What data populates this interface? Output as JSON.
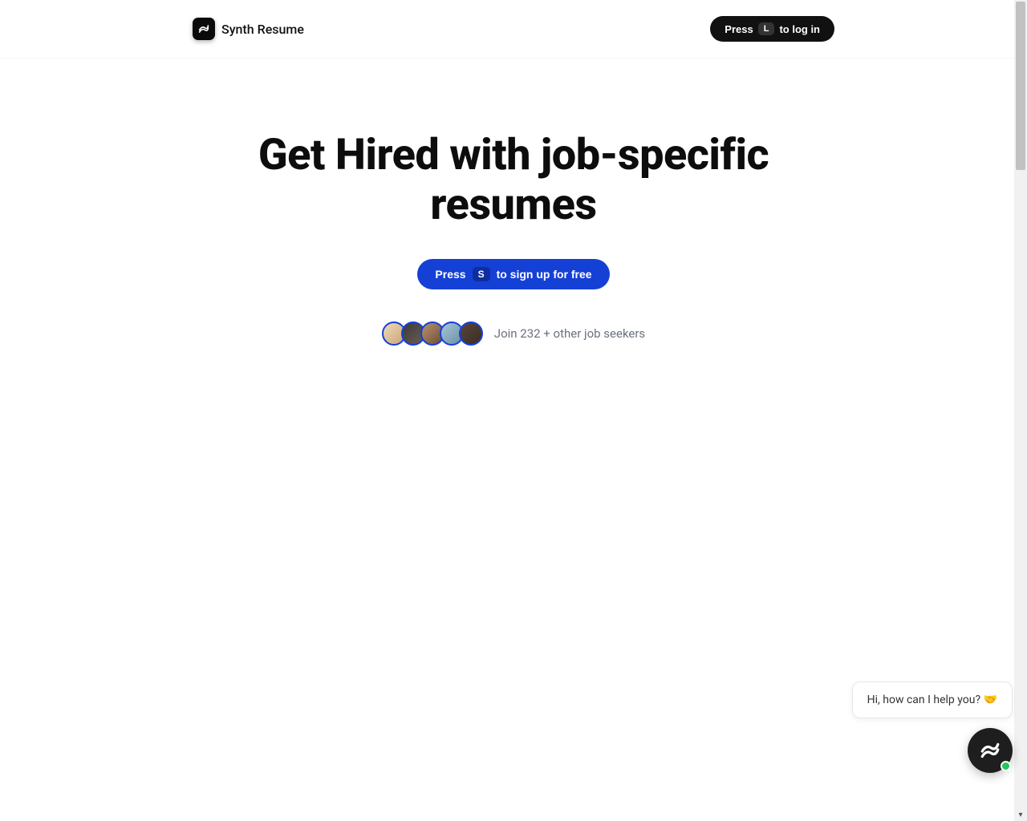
{
  "header": {
    "brand_name": "Synth Resume",
    "login_press": "Press",
    "login_key": "L",
    "login_action": "to log in"
  },
  "hero": {
    "title": "Get Hired with job-specific resumes",
    "signup_press": "Press",
    "signup_key": "S",
    "signup_action": "to sign up for free"
  },
  "social_proof": {
    "text": "Join 232 + other job seekers"
  },
  "chat": {
    "greeting": "Hi, how can I help you? 🤝"
  }
}
